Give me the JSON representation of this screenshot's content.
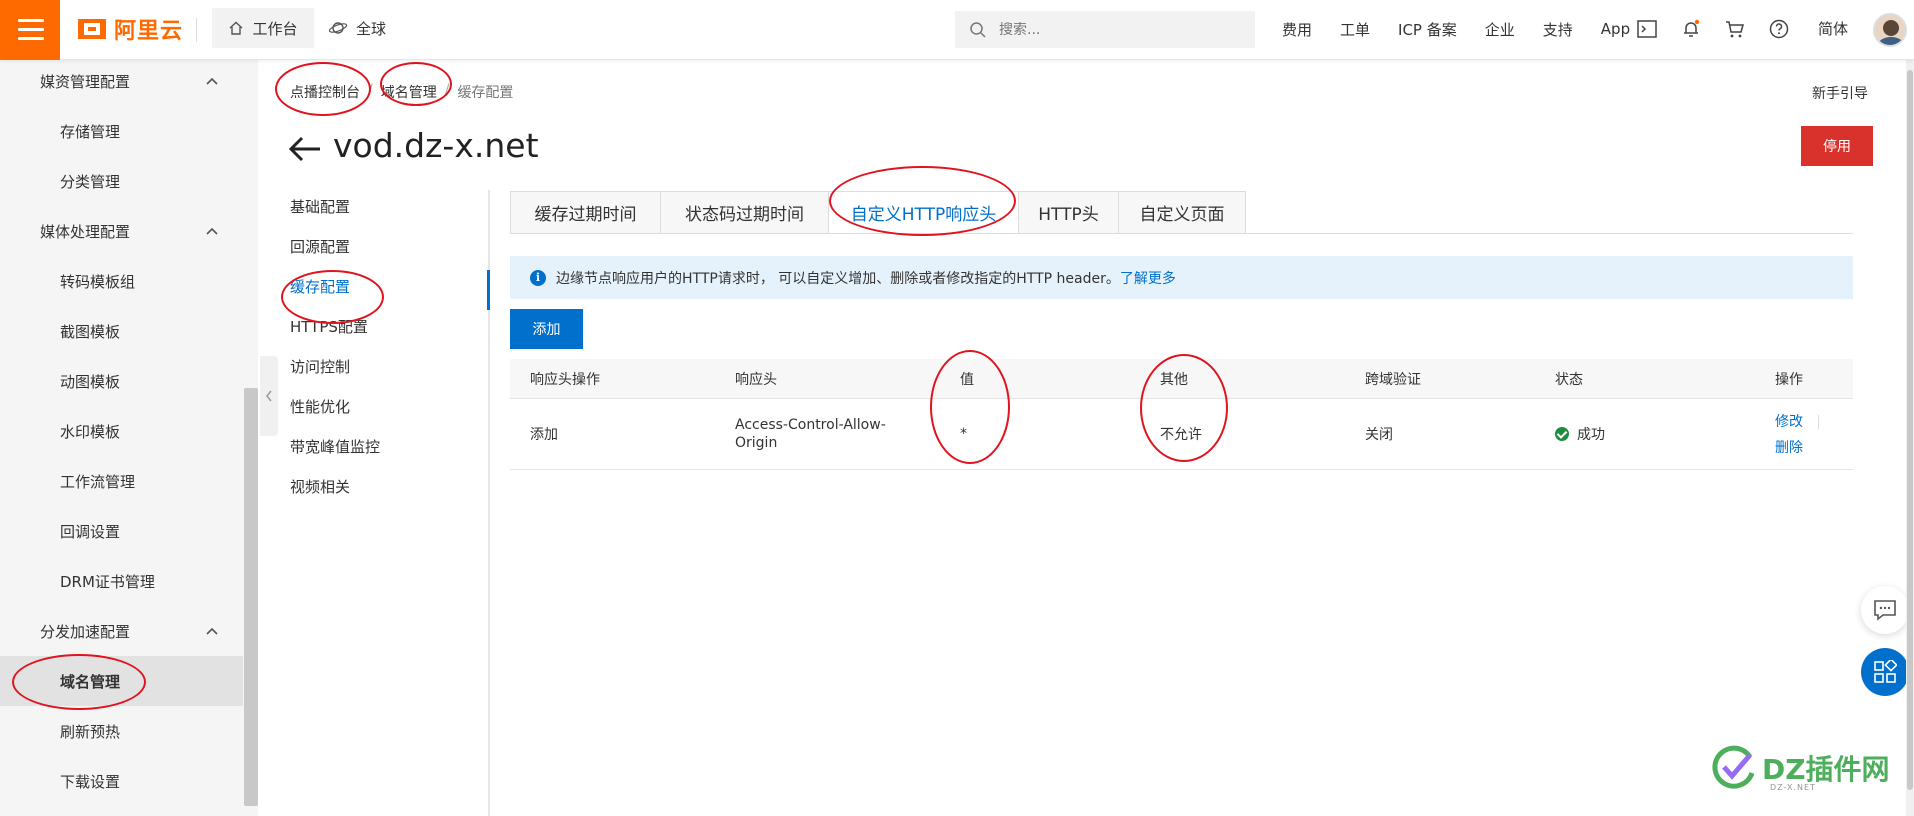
{
  "topbar": {
    "logo_text": "阿里云",
    "workbench_label": "工作台",
    "global_label": "全球",
    "search_placeholder": "搜索...",
    "links": [
      "费用",
      "工单",
      "ICP 备案",
      "企业",
      "支持",
      "App"
    ],
    "lang": "简体",
    "brand_color": "#ff6a00"
  },
  "sidebar": {
    "groups": [
      {
        "label": "媒资管理配置",
        "items": [
          "存储管理",
          "分类管理"
        ]
      },
      {
        "label": "媒体处理配置",
        "items": [
          "转码模板组",
          "截图模板",
          "动图模板",
          "水印模板",
          "工作流管理",
          "回调设置",
          "DRM证书管理"
        ]
      },
      {
        "label": "分发加速配置",
        "items": [
          "域名管理",
          "刷新预热",
          "下载设置"
        ]
      }
    ],
    "active_item": "域名管理"
  },
  "breadcrumb": {
    "items": [
      "点播控制台",
      "域名管理",
      "缓存配置"
    ]
  },
  "guide_label": "新手引导",
  "domain_title": "vod.dz-x.net",
  "disable_button": "停用",
  "subnav": {
    "items": [
      "基础配置",
      "回源配置",
      "缓存配置",
      "HTTPS配置",
      "访问控制",
      "性能优化",
      "带宽峰值监控",
      "视频相关"
    ],
    "active": "缓存配置"
  },
  "tabs": {
    "items": [
      "缓存过期时间",
      "状态码过期时间",
      "自定义HTTP响应头",
      "HTTP头",
      "自定义页面"
    ],
    "active": "自定义HTTP响应头"
  },
  "info": {
    "text": "边缘节点响应用户的HTTP请求时， 可以自定义增加、删除或者修改指定的HTTP header。",
    "link": "了解更多"
  },
  "add_button": "添加",
  "table": {
    "headers": [
      "响应头操作",
      "响应头",
      "值",
      "其他",
      "跨域验证",
      "状态",
      "操作"
    ],
    "rows": [
      {
        "op": "添加",
        "header": "Access-Control-Allow-\nOrigin",
        "value": "*",
        "other": "不允许",
        "cors": "关闭",
        "status": "成功",
        "actions": [
          "修改",
          "删除"
        ]
      }
    ]
  },
  "watermark": {
    "text": "DZ插件网",
    "sub": "DZ-X.NET"
  },
  "colors": {
    "accent": "#0070cc",
    "danger": "#d9312c",
    "success": "#1e8e3e",
    "annotation": "#e0141e"
  }
}
